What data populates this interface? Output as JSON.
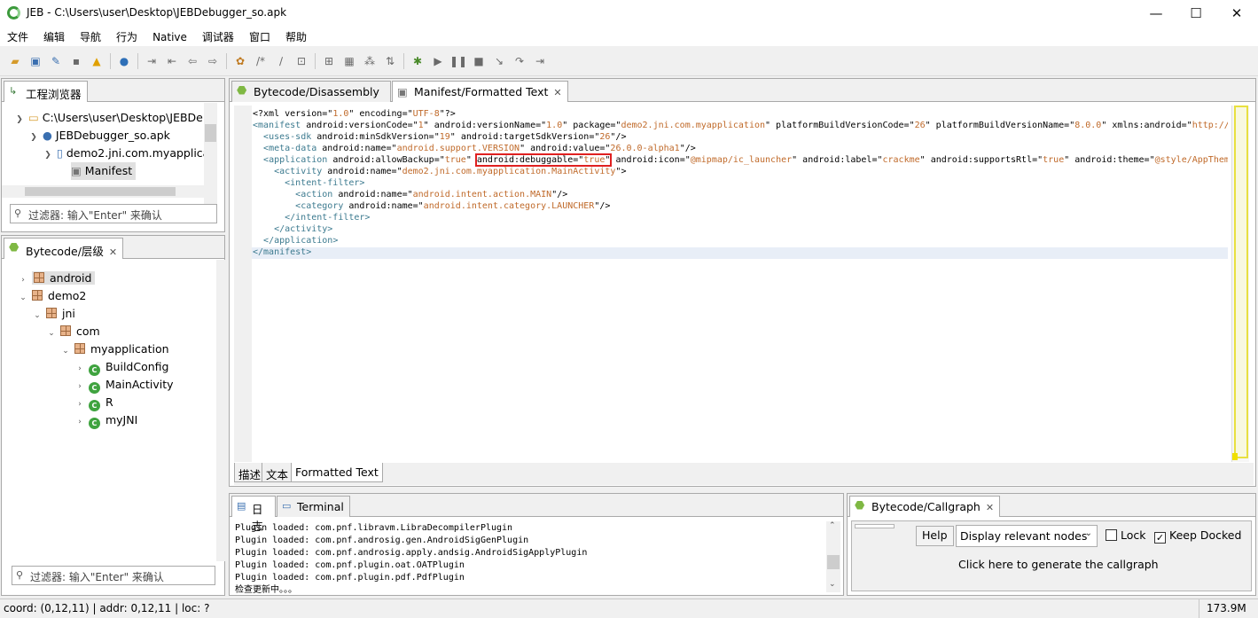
{
  "window": {
    "title": "JEB - C:\\Users\\user\\Desktop\\JEBDebugger_so.apk",
    "minimize": "—",
    "maximize": "☐",
    "close": "✕"
  },
  "menu": [
    "文件",
    "编辑",
    "导航",
    "行为",
    "Native",
    "调试器",
    "窗口",
    "帮助"
  ],
  "project_explorer": {
    "tab": "工程浏览器",
    "items": [
      {
        "label": "C:\\Users\\user\\Desktop\\JEBDe"
      },
      {
        "label": "JEBDebugger_so.apk"
      },
      {
        "label": "demo2.jni.com.myapplica"
      },
      {
        "label": "Manifest"
      }
    ],
    "filter_placeholder": "过滤器: 输入\"Enter\" 来确认"
  },
  "hierarchy": {
    "tab": "Bytecode/层级",
    "items": [
      {
        "label": "android"
      },
      {
        "label": "demo2"
      },
      {
        "label": "jni"
      },
      {
        "label": "com"
      },
      {
        "label": "myapplication"
      },
      {
        "label": "BuildConfig"
      },
      {
        "label": "MainActivity"
      },
      {
        "label": "R"
      },
      {
        "label": "myJNI"
      }
    ],
    "filter_placeholder": "过滤器: 输入\"Enter\" 来确认"
  },
  "editor": {
    "tabs": [
      "Bytecode/Disassembly",
      "Manifest/Formatted Text"
    ],
    "bottom_tabs": [
      "描述",
      "文本",
      "Formatted Text"
    ]
  },
  "console": {
    "tabs": [
      "日志",
      "Terminal"
    ],
    "lines": [
      "Plugin loaded: com.pnf.libravm.LibraDecompilerPlugin",
      "Plugin loaded: com.pnf.androsig.gen.AndroidSigGenPlugin",
      "Plugin loaded: com.pnf.androsig.apply.andsig.AndroidSigApplyPlugin",
      "Plugin loaded: com.pnf.plugin.oat.OATPlugin",
      "Plugin loaded: com.pnf.plugin.pdf.PdfPlugin",
      "检查更新中。。。"
    ]
  },
  "callgraph": {
    "tab": "Bytecode/Callgraph",
    "help": "Help",
    "select": "Display relevant nodes",
    "lock": "Lock",
    "keep_docked": "Keep Docked",
    "hint": "Click here to generate the callgraph"
  },
  "status": {
    "coord": "coord: (0,12,11) | addr: 0,12,11 | loc: ?",
    "memory": "173.9M"
  },
  "colors": {
    "highlight_box": "#e02020",
    "tag": "#3c7a8f",
    "value": "#c06a2a"
  }
}
